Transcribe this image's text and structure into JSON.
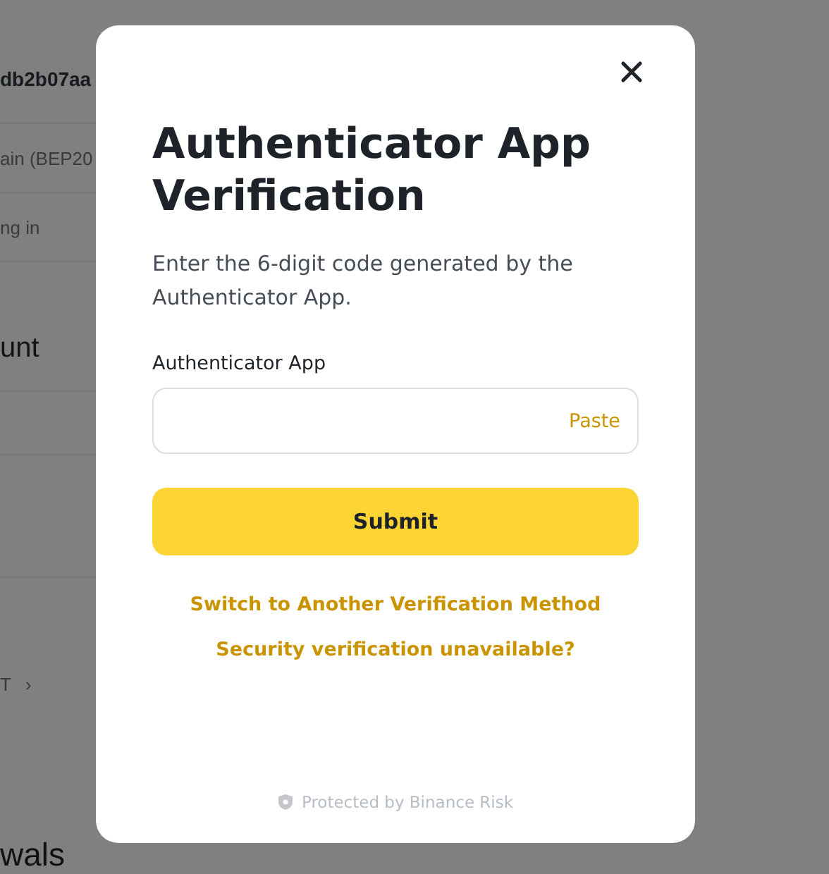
{
  "background_page": {
    "items": [
      {
        "kind": "value",
        "text": "db2b07aa"
      },
      {
        "kind": "detail",
        "text": "ain (BEP20"
      },
      {
        "kind": "detail",
        "text": "ng in"
      },
      {
        "kind": "heading",
        "text": "unt"
      },
      {
        "kind": "spacer"
      },
      {
        "kind": "spacer"
      },
      {
        "kind": "link",
        "text": "T",
        "chevron": "›"
      },
      {
        "kind": "big-heading",
        "text": "wals"
      }
    ]
  },
  "dialog": {
    "title": "Authenticator App Verification",
    "description": "Enter the 6-digit code generated by the Authenticator App.",
    "field_label": "Authenticator App",
    "field": {
      "action": "Paste"
    },
    "submit": "Submit",
    "links": [
      "Switch to Another Verification Method",
      "Security verification unavailable?"
    ],
    "footer": "Protected by Binance Risk"
  }
}
